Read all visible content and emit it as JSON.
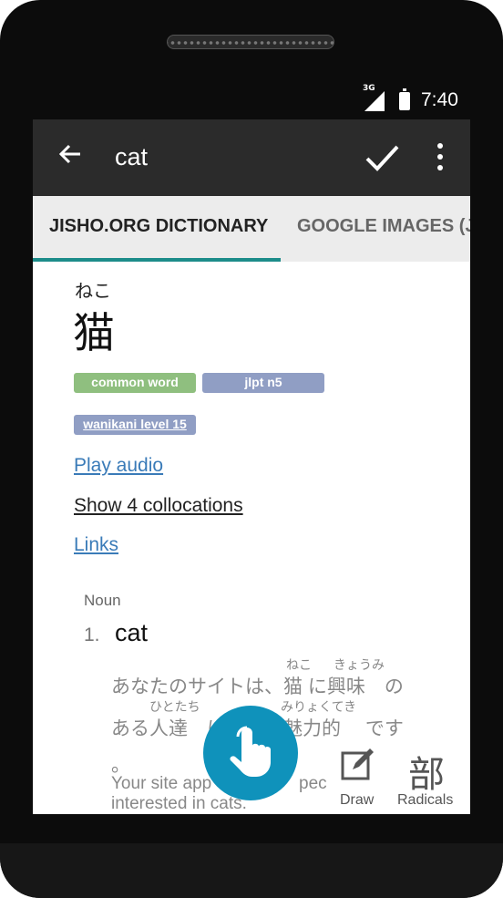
{
  "status": {
    "network": "3G",
    "time": "7:40"
  },
  "appbar": {
    "title": "cat"
  },
  "tabs": [
    {
      "label": "JISHO.ORG DICTIONARY"
    },
    {
      "label": "GOOGLE IMAGES (JI"
    }
  ],
  "entry": {
    "furigana": "ねこ",
    "word": "猫",
    "tags": [
      "common word",
      "jlpt n5",
      "wanikani level 15"
    ],
    "links": [
      "Play audio",
      "Show 4 collocations",
      "Links"
    ],
    "part_of_speech": "Noun",
    "sense_number": "1.",
    "meaning": "cat",
    "example": {
      "line1": "あなたのサイトは、猫 に興味　の",
      "ruby1a": "ねこ",
      "ruby1b": "きょうみ",
      "line2": "ある人達　に　　　魅力的　 です",
      "ruby2a": "ひとたち",
      "ruby2b": "みりょくてき",
      "line3": "。",
      "translation1": "Your site app",
      "translation1b": "pec",
      "translation2": "interested in cats."
    }
  },
  "bottom": {
    "draw_label": "Draw",
    "radicals_icon": "部",
    "radicals_label": "Radicals"
  }
}
